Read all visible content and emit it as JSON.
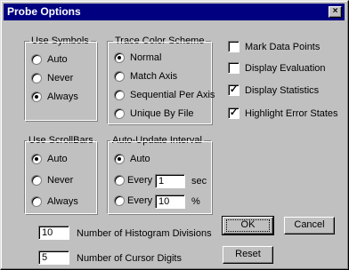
{
  "window": {
    "title": "Probe Options",
    "close_glyph": "×"
  },
  "use_symbols": {
    "legend": "Use Symbols",
    "options": [
      {
        "label": "Auto",
        "selected": false
      },
      {
        "label": "Never",
        "selected": false
      },
      {
        "label": "Always",
        "selected": true
      }
    ]
  },
  "trace_color": {
    "legend": "Trace Color Scheme",
    "options": [
      {
        "label": "Normal",
        "selected": true
      },
      {
        "label": "Match Axis",
        "selected": false
      },
      {
        "label": "Sequential Per Axis",
        "selected": false
      },
      {
        "label": "Unique By File",
        "selected": false
      }
    ]
  },
  "checkboxes": [
    {
      "label": "Mark Data Points",
      "checked": false
    },
    {
      "label": "Display Evaluation",
      "checked": false
    },
    {
      "label": "Display Statistics",
      "checked": true
    },
    {
      "label": "Highlight Error States",
      "checked": true
    }
  ],
  "use_scrollbars": {
    "legend": "Use ScrollBars",
    "options": [
      {
        "label": "Auto",
        "selected": true
      },
      {
        "label": "Never",
        "selected": false
      },
      {
        "label": "Always",
        "selected": false
      }
    ]
  },
  "auto_update": {
    "legend": "Auto-Update Interval",
    "auto_label": "Auto",
    "every_label": "Every",
    "sec_value": "1",
    "sec_unit": "sec",
    "pct_value": "10",
    "pct_unit": "%",
    "selected": "Auto"
  },
  "histogram": {
    "value": "10",
    "label": "Number of Histogram Divisions"
  },
  "cursor_digits": {
    "value": "5",
    "label": "Number of Cursor Digits"
  },
  "buttons": {
    "ok": "OK",
    "cancel": "Cancel",
    "reset": "Reset"
  },
  "check_glyph": "✓"
}
